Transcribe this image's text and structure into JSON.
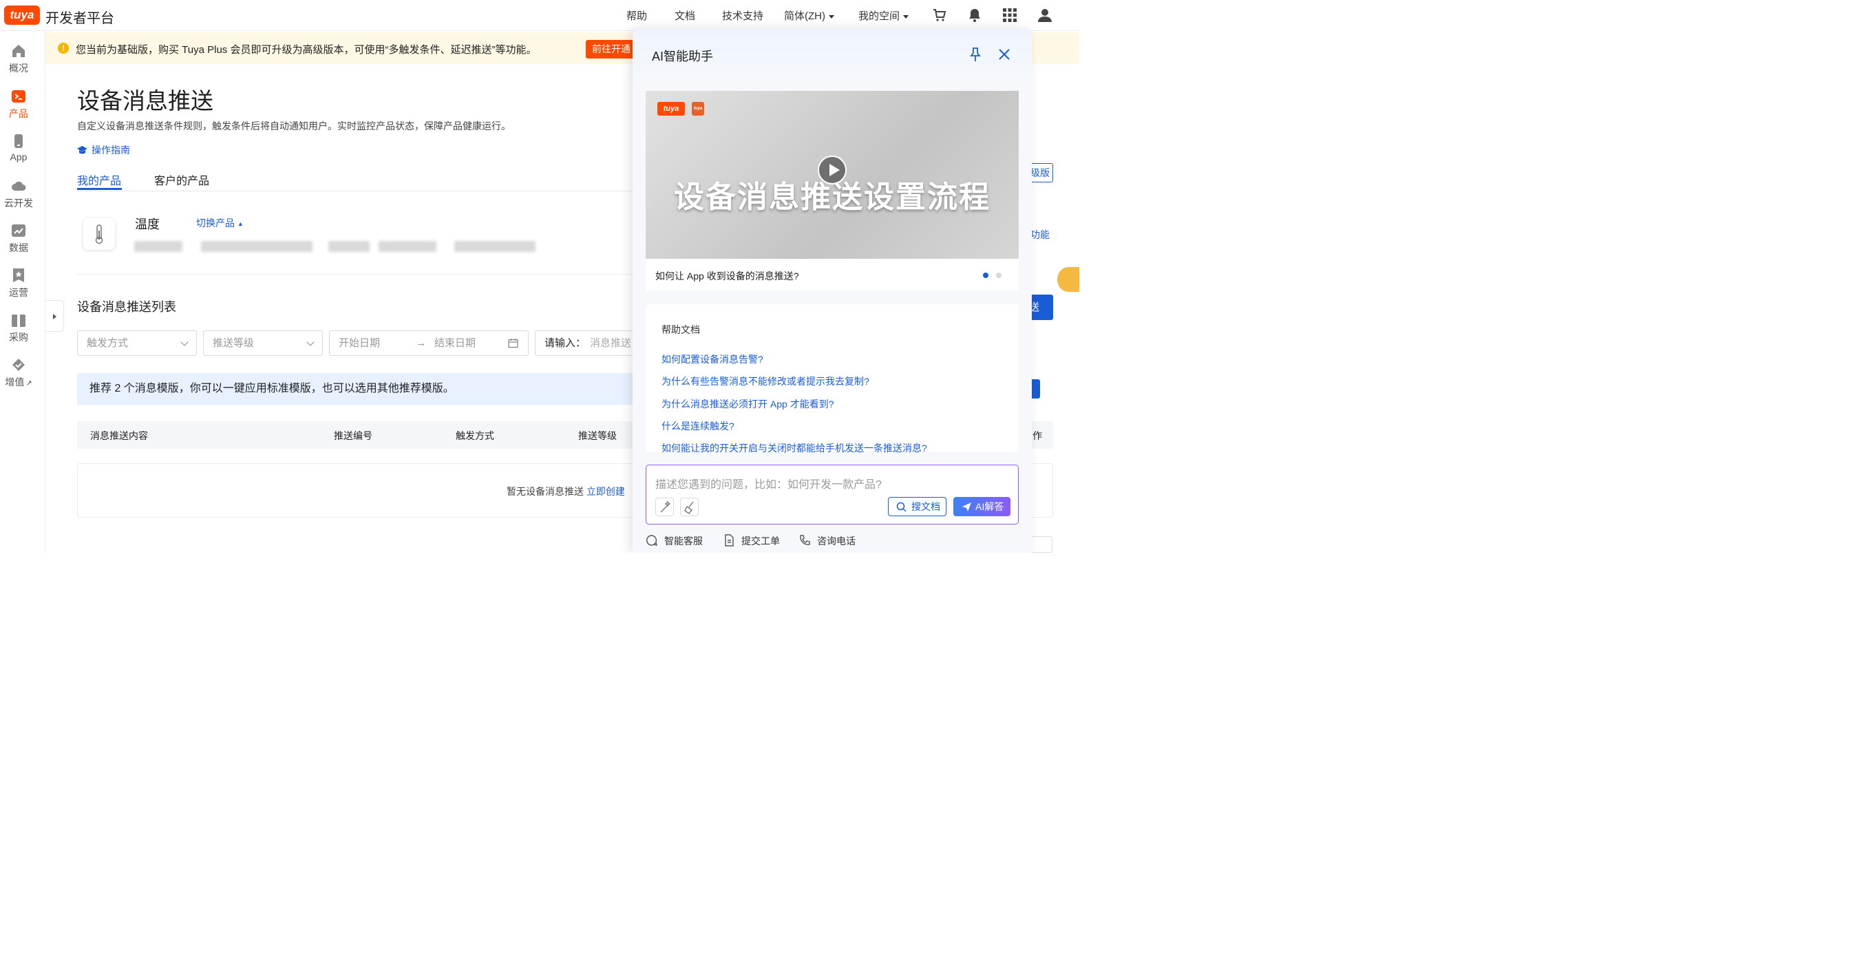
{
  "topbar": {
    "logo_text": "tuya",
    "brand": "开发者平台",
    "nav": {
      "help": "帮助",
      "docs": "文档",
      "support": "技术支持",
      "language": "简体(ZH)",
      "space": "我的空间"
    },
    "icons": [
      "cart-icon",
      "bell-icon",
      "grid-icon",
      "user-icon"
    ]
  },
  "sidebar": {
    "items": [
      {
        "label": "概况",
        "icon": "home-icon"
      },
      {
        "label": "产品",
        "icon": "product-icon",
        "active": true
      },
      {
        "label": "App",
        "icon": "phone-icon"
      },
      {
        "label": "云开发",
        "icon": "cloud-icon"
      },
      {
        "label": "数据",
        "icon": "chart-icon"
      },
      {
        "label": "运营",
        "icon": "star-icon"
      },
      {
        "label": "采购",
        "icon": "box-icon"
      },
      {
        "label": "增值",
        "icon": "diamond-icon",
        "external": "↗"
      }
    ]
  },
  "banner": {
    "text": "您当前为基础版，购买 Tuya Plus 会员即可升级为高级版本，可使用“多触发条件、延迟推送”等功能。",
    "button": "前往开通"
  },
  "main": {
    "title": "设备消息推送",
    "description": "自定义设备消息推送条件规则，触发条件后将自动通知用户。实时监控产品状态，保障产品健康运行。",
    "guide": "操作指南",
    "tabs": [
      {
        "label": "我的产品",
        "active": true
      },
      {
        "label": "客户的产品",
        "active": false
      }
    ],
    "product": {
      "name": "温度",
      "switch": "切换产品"
    },
    "list_title": "设备消息推送列表",
    "filters": {
      "trigger_placeholder": "触发方式",
      "level_placeholder": "推送等级",
      "start_date": "开始日期",
      "arrow": "→",
      "end_date": "结束日期",
      "search_label": "请输入：",
      "search_placeholder": "消息推送"
    },
    "recommend_text": "推荐 2 个消息模版，你可以一键应用标准模版，也可以选用其他推荐模版。",
    "table_headers": [
      "消息推送内容",
      "推送编号",
      "触发方式",
      "推送等级",
      "作"
    ],
    "empty_text": "暂无设备消息推送",
    "empty_link": "立即创建",
    "peek": {
      "upgrade": "级版",
      "feature": "功能",
      "send": "送"
    }
  },
  "ai_panel": {
    "title": "AI智能助手",
    "video": {
      "title": "设备消息推送设置流程",
      "logo1": "tuya",
      "logo2": "tuya",
      "caption": "如何让 App 收到设备的消息推送?"
    },
    "docs": {
      "label": "帮助文档",
      "links": [
        "如何配置设备消息告警?",
        "为什么有些告警消息不能修改或者提示我去复制?",
        "为什么消息推送必须打开 App 才能看到?",
        "什么是连续触发?",
        "如何能让我的开关开启与关闭时都能给手机发送一条推送消息?"
      ]
    },
    "input": {
      "placeholder": "描述您遇到的问题，比如：如何开发一款产品?",
      "search_docs": "搜文档",
      "ai_answer": "AI解答"
    },
    "footer": {
      "service": "智能客服",
      "ticket": "提交工单",
      "phone": "咨询电话"
    }
  },
  "colors": {
    "brand": "#ff4800",
    "link": "#1a5cd6",
    "banner_bg": "#fff8e5",
    "recommend_bg": "#e8f1ff",
    "ai_accent": "#8b5cf6"
  }
}
